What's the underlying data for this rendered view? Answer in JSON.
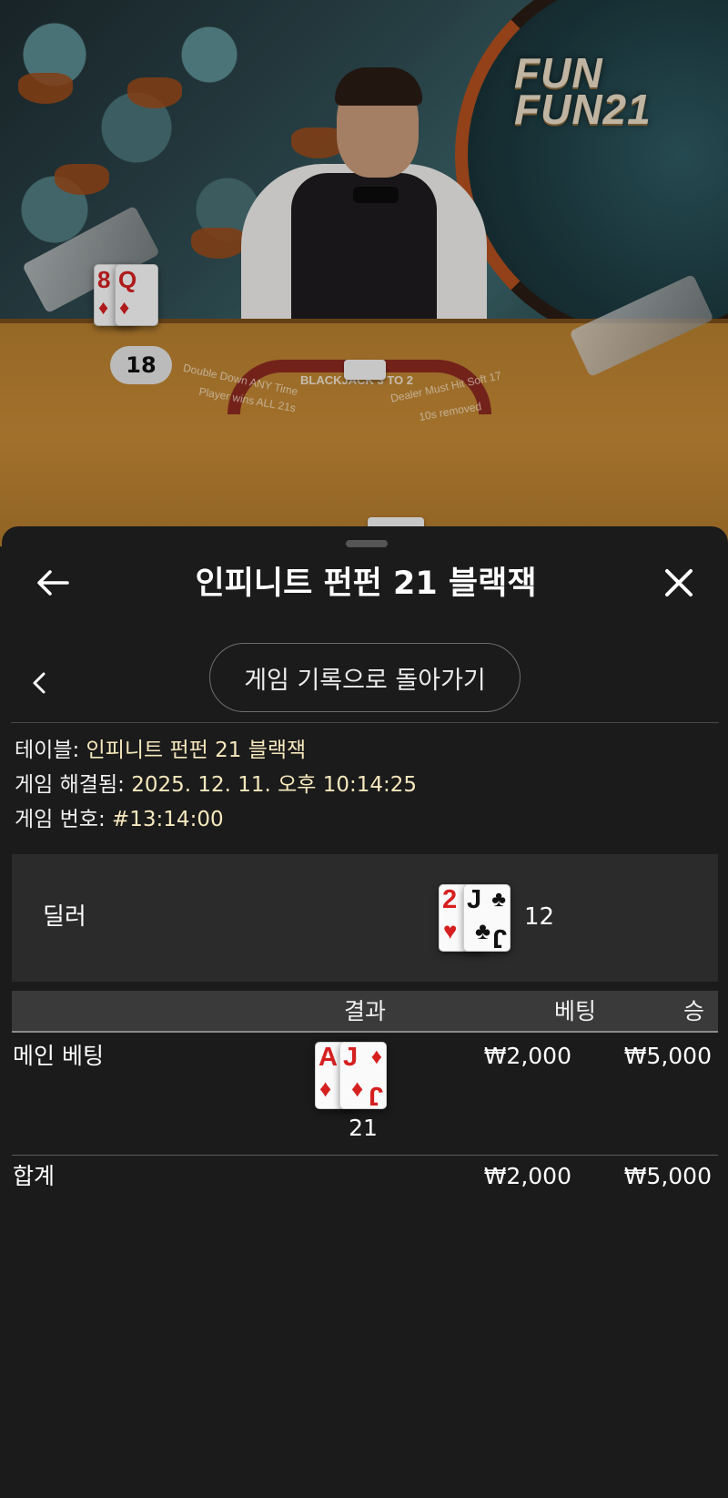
{
  "scene": {
    "logo_line1": "FUN",
    "logo_line2": "FUN21",
    "felt_main": "BLACKJACK 3 TO 2",
    "felt_left1": "Double Down ANY Time",
    "felt_left2": "Player wins ALL 21s",
    "felt_right1": "Dealer Must Hit Soft 17",
    "felt_right2": "10s removed",
    "player_score": "18",
    "table_cards": [
      {
        "rank": "8",
        "suit": "♦"
      },
      {
        "rank": "Q",
        "suit": "♦"
      }
    ]
  },
  "header": {
    "back_icon": "arrow-left-icon",
    "title": "인피니트 펀펀 21 블랙잭",
    "close_icon": "close-icon"
  },
  "nav": {
    "prev_icon": "chevron-left-icon",
    "history_button": "게임 기록으로 돌아가기"
  },
  "info": {
    "table_label": "테이블:",
    "table_value": "인피니트 펀펀 21 블랙잭",
    "resolved_label": "게임 해결됨:",
    "resolved_value": "2025. 12. 11. 오후 10:14:25",
    "game_no_label": "게임 번호:",
    "game_no_value": "#13:14:00"
  },
  "dealer": {
    "label": "딜러",
    "cards": [
      {
        "rank": "2",
        "suit": "♥",
        "color": "#d62020"
      },
      {
        "rank": "J",
        "suit": "♣",
        "color": "#111111"
      }
    ],
    "total": "12"
  },
  "results": {
    "headers": {
      "result": "결과",
      "bet": "베팅",
      "win": "승"
    },
    "main_bet": {
      "label": "메인 베팅",
      "cards": [
        {
          "rank": "A",
          "suit": "♦",
          "color": "#d62020"
        },
        {
          "rank": "J",
          "suit": "♦",
          "color": "#d62020"
        }
      ],
      "total": "21",
      "bet": "₩2,000",
      "win": "₩5,000"
    },
    "sum": {
      "label": "합계",
      "bet": "₩2,000",
      "win": "₩5,000"
    }
  }
}
